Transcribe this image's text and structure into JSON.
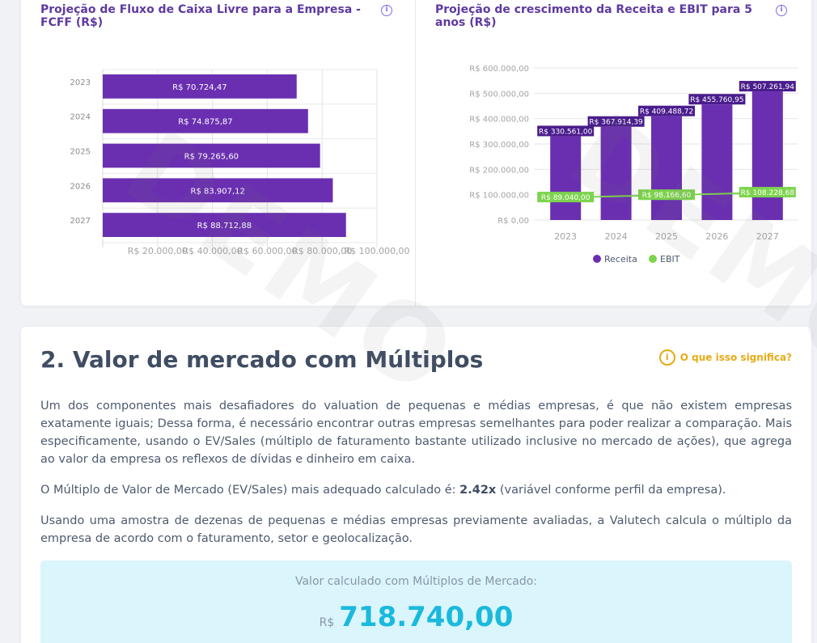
{
  "fcff_panel": {
    "title": "Projeção de Fluxo de Caixa Livre para a Empresa - FCFF (R$)",
    "info_icon": "info-circle-icon"
  },
  "growth_panel": {
    "title": "Projeção de crescimento da Receita e EBIT para 5 anos (R$)",
    "info_icon": "info-circle-icon"
  },
  "chart_data": [
    {
      "type": "bar",
      "orientation": "horizontal",
      "title": "Projeção de Fluxo de Caixa Livre para a Empresa - FCFF (R$)",
      "categories": [
        "2023",
        "2024",
        "2025",
        "2026",
        "2027"
      ],
      "values": [
        70724.47,
        74875.87,
        79265.6,
        83907.12,
        88712.88
      ],
      "data_labels": [
        "R$ 70.724,47",
        "R$ 74.875,87",
        "R$ 79.265,60",
        "R$ 83.907,12",
        "R$ 88.712,88"
      ],
      "xlim": [
        0,
        100000
      ],
      "x_ticks": [
        20000,
        40000,
        60000,
        80000,
        100000
      ],
      "x_tick_labels": [
        "R$ 20.000,00",
        "R$ 40.000,00",
        "R$ 60.000,00",
        "R$ 80.000,00",
        "R$ 100.000,00"
      ],
      "color": "#6a2fb0",
      "grid": true
    },
    {
      "type": "bar",
      "title": "Projeção de crescimento da Receita e EBIT para 5 anos (R$)",
      "categories": [
        "2023",
        "2024",
        "2025",
        "2026",
        "2027"
      ],
      "series": [
        {
          "name": "Receita",
          "type": "bar",
          "color": "#6a2fb0",
          "values": [
            330561.0,
            367914.39,
            409488.72,
            455760.95,
            507261.94
          ],
          "labels": [
            "R$ 330.561,00",
            "R$ 367.914,39",
            "R$ 409.488,72",
            "R$ 455.760,95",
            "R$ 507.261,94"
          ]
        },
        {
          "name": "EBIT",
          "type": "line",
          "color": "#7dd34d",
          "values": [
            89040.0,
            null,
            98166.6,
            null,
            108228.68
          ],
          "labels": [
            "R$ 89.040,00",
            null,
            "R$ 98.166,60",
            null,
            "R$ 108.228,68"
          ]
        }
      ],
      "ylim": [
        0,
        600000
      ],
      "y_ticks": [
        0,
        100000,
        200000,
        300000,
        400000,
        500000,
        600000
      ],
      "y_tick_labels": [
        "R$ 0,00",
        "R$ 100.000,00",
        "R$ 200.000,00",
        "R$ 300.000,00",
        "R$ 400.000,00",
        "R$ 500.000,00",
        "R$ 600.000,00"
      ],
      "legend": "bottom-center",
      "grid": true
    }
  ],
  "section": {
    "title": "2. Valor de mercado com Múltiplos",
    "help_label": "O que isso significa?",
    "help_icon": "info-circle-icon",
    "paragraph_1": "Um dos componentes mais desafiadores do valuation de pequenas e médias empresas, é que não existem empresas exatamente iguais; Dessa forma, é necessário encontrar outras empresas semelhantes para poder realizar a comparação. Mais especificamente, usando o EV/Sales (múltiplo de faturamento bastante utilizado inclusive no mercado de ações), que agrega ao valor da empresa os reflexos de dívidas e dinheiro em caixa.",
    "paragraph_2_prefix": "O Múltiplo de Valor de Mercado (EV/Sales) mais adequado calculado é: ",
    "paragraph_2_value": "2.42x",
    "paragraph_2_suffix": " (variável conforme perfil da empresa).",
    "paragraph_3": "Usando uma amostra de dezenas de pequenas e médias empresas previamente avaliadas, a Valutech calcula o múltiplo da empresa de acordo com o faturamento, setor e geolocalização.",
    "result_label": "Valor calculado com Múltiplos de Mercado:",
    "result_currency": "R$",
    "result_value": "718.740,00"
  },
  "watermark_text": "DEMO",
  "colors": {
    "accent_purple": "#6a2fb0",
    "ebit_green": "#7dd34d",
    "result_cyan": "#1ab9dd",
    "help_yellow": "#e7ab14"
  }
}
